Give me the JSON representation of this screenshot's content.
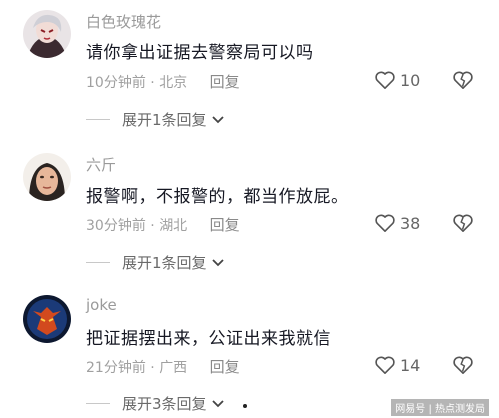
{
  "comments": [
    {
      "username": "白色玫瑰花",
      "text": "请你拿出证据去警察局可以吗",
      "time": "10分钟前",
      "location": "北京",
      "reply_label": "回复",
      "likes": "10",
      "expand_label": "展开1条回复"
    },
    {
      "username": "六斤",
      "text": "报警啊，不报警的，都当作放屁。",
      "time": "30分钟前",
      "location": "湖北",
      "reply_label": "回复",
      "likes": "38",
      "expand_label": "展开1条回复"
    },
    {
      "username": "joke",
      "text": "把证据摆出来，公证出来我就信",
      "time": "21分钟前",
      "location": "广西",
      "reply_label": "回复",
      "likes": "14",
      "expand_label": "展开3条回复"
    }
  ],
  "separator": " · ",
  "watermark": "网易号 | 热点测发局",
  "colors": {
    "text": "#161823",
    "muted": "#9a9a9a"
  }
}
